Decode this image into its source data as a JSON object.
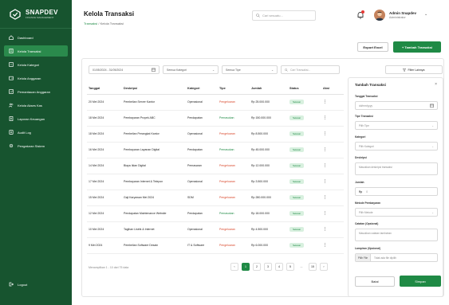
{
  "brand": {
    "name": "SNAPDEV",
    "tagline": "FINANCE MANAGEMENT"
  },
  "sidebar": {
    "items": [
      {
        "label": "Dashboard",
        "icon": "home-icon"
      },
      {
        "label": "Kelola Transaksi",
        "icon": "receipt-icon",
        "active": true
      },
      {
        "label": "Kelola Kategori",
        "icon": "tag-icon"
      },
      {
        "label": "Kelola Anggaran",
        "icon": "wallet-icon"
      },
      {
        "label": "Pemantauan Anggaran",
        "icon": "chart-icon"
      },
      {
        "label": "Kelola Akses Kas",
        "icon": "users-icon"
      },
      {
        "label": "Laporan Keuangan",
        "icon": "report-icon"
      },
      {
        "label": "Audit Log",
        "icon": "log-icon"
      },
      {
        "label": "Pengaturan Sistem",
        "icon": "gear-icon"
      }
    ],
    "logout": "Logout"
  },
  "header": {
    "title": "Kelola Transaksi",
    "breadcrumb_home": "Transaksi",
    "breadcrumb_sep": "/",
    "breadcrumb_current": "Kelola Transaksi",
    "search_placeholder": "Cari sesuatu...",
    "user_name": "Admin Snapdev",
    "user_role": "Administrator"
  },
  "actions": {
    "export": "Export Excel",
    "add": "+ Tambah Transaksi"
  },
  "filters": {
    "date_range": "01/05/2024 - 31/05/2024",
    "category": "Semua Kategori",
    "type": "Semua Tipe",
    "search_placeholder": "Cari Transaksi...",
    "more": "Filter Lainnya"
  },
  "table": {
    "headers": [
      "Tanggal",
      "Deskripsi",
      "Kategori",
      "Tipe",
      "Jumlah",
      "Status",
      "Aksi"
    ],
    "rows": [
      {
        "date": "20 Mei 2024",
        "desc": "Pembelian Server Kantor",
        "cat": "Operasional",
        "type": "Pengeluaran",
        "amount": "Rp 25.000.000",
        "status": "Selesai"
      },
      {
        "date": "18 Mei 2024",
        "desc": "Pembayaran Proyek ABC",
        "cat": "Pendapatan",
        "type": "Pemasukan",
        "amount": "Rp 150.000.000",
        "status": "Selesai"
      },
      {
        "date": "18 Mei 2024",
        "desc": "Pembelian Perangkat Kantor",
        "cat": "Operasional",
        "type": "Pengeluaran",
        "amount": "Rp 8.500.000",
        "status": "Selesai"
      },
      {
        "date": "16 Mei 2024",
        "desc": "Pembayaran Layanan Digital",
        "cat": "Pendapatan",
        "type": "Pemasukan",
        "amount": "Rp 45.000.000",
        "status": "Selesai"
      },
      {
        "date": "14 Mei 2024",
        "desc": "Biaya Iklan Digital",
        "cat": "Pemasaran",
        "type": "Pengeluaran",
        "amount": "Rp 12.000.000",
        "status": "Selesai"
      },
      {
        "date": "17 Mei 2024",
        "desc": "Pembayaran Internet & Telepon",
        "cat": "Operasional",
        "type": "Pengeluaran",
        "amount": "Rp 3.500.000",
        "status": "Selesai"
      },
      {
        "date": "15 Mei 2024",
        "desc": "Gaji Karyawan Mei 2024",
        "cat": "SDM",
        "type": "Pengeluaran",
        "amount": "Rp 280.000.000",
        "status": "Selesai"
      },
      {
        "date": "12 Mei 2024",
        "desc": "Pendapatan Maintenance Website",
        "cat": "Pendapatan",
        "type": "Pemasukan",
        "amount": "Rp 18.000.000",
        "status": "Selesai"
      },
      {
        "date": "10 Mei 2024",
        "desc": "Tagihan Listrik & Internet",
        "cat": "Operasional",
        "type": "Pengeluaran",
        "amount": "Rp 4.500.000",
        "status": "Selesai"
      },
      {
        "date": "9 Mei 2024",
        "desc": "Pembelian Software Desain",
        "cat": "IT & Software",
        "type": "Pengeluaran",
        "amount": "Rp 6.000.000",
        "status": "Selesai"
      }
    ]
  },
  "footer": {
    "info": "Menampilkan 1 - 10 dari 75 data",
    "pages": [
      "‹",
      "1",
      "2",
      "3",
      "4",
      "5",
      "...",
      "15",
      "›"
    ]
  },
  "panel": {
    "title": "Tambah Transaksi",
    "date_label": "Tanggal Transaksi",
    "date_placeholder": "dd/mm/yyyy",
    "type_label": "Tipe Transaksi",
    "type_value": "Pilih Tipe",
    "cat_label": "Kategori",
    "cat_value": "Pilih Kategori",
    "desc_label": "Deskripsi",
    "desc_placeholder": "Masukkan deskripsi transaksi",
    "amount_label": "Jumlah",
    "amount_prefix": "Rp",
    "amount_value": "0",
    "method_label": "Metode Pembayaran",
    "method_value": "Pilih Metode",
    "note_label": "Catatan (Opsional)",
    "note_placeholder": "Masukkan catatan tambahan",
    "attach_label": "Lampiran (Opsional)",
    "attach_button": "Pilih File",
    "attach_value": "Tidak ada file dipilih",
    "cancel": "Batal",
    "save": "Simpan"
  },
  "colors": {
    "brand": "#17542f",
    "accent": "#1f8a45",
    "expense": "#d9472b"
  }
}
